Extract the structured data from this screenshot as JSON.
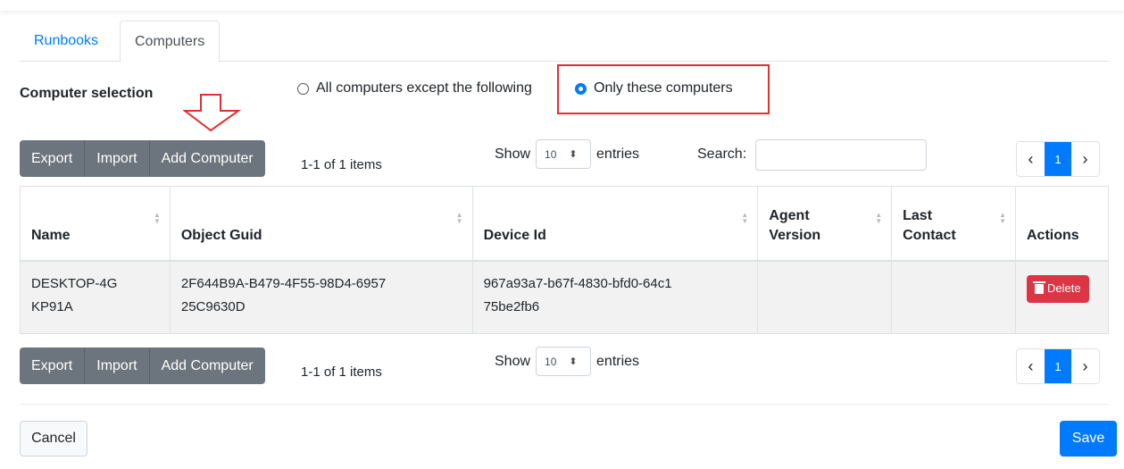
{
  "tabs": [
    {
      "label": "Runbooks",
      "active": false
    },
    {
      "label": "Computers",
      "active": true
    }
  ],
  "selection": {
    "label": "Computer selection",
    "options": [
      {
        "label": "All computers except the following",
        "selected": false
      },
      {
        "label": "Only these computers",
        "selected": true
      }
    ]
  },
  "toolbar": {
    "export_label": "Export",
    "import_label": "Import",
    "add_label": "Add Computer",
    "items_text": "1-1 of 1 items",
    "show_label": "Show",
    "page_size": "10",
    "entries_label": "entries",
    "search_label": "Search:",
    "search_value": ""
  },
  "pager": {
    "current_page": "1",
    "prev_icon": "chevron-left-icon",
    "next_icon": "chevron-right-icon"
  },
  "table": {
    "columns": [
      {
        "label": "Name"
      },
      {
        "label": "Object Guid"
      },
      {
        "label": "Device Id"
      },
      {
        "label": "Agent Version"
      },
      {
        "label": "Last Contact"
      },
      {
        "label": "Actions"
      }
    ],
    "rows": [
      {
        "name": "DESKTOP-4GKP91A",
        "object_guid": "2F644B9A-B479-4F55-98D4-695725C9630D",
        "device_id": "967a93a7-b67f-4830-bfd0-64c175be2fb6",
        "agent_version": "",
        "last_contact": "",
        "action_label": "Delete"
      }
    ]
  },
  "footer": {
    "cancel_label": "Cancel",
    "save_label": "Save"
  },
  "colors": {
    "primary": "#007bff",
    "secondary": "#6c757d",
    "danger": "#dc3545",
    "highlight": "#e03030"
  }
}
